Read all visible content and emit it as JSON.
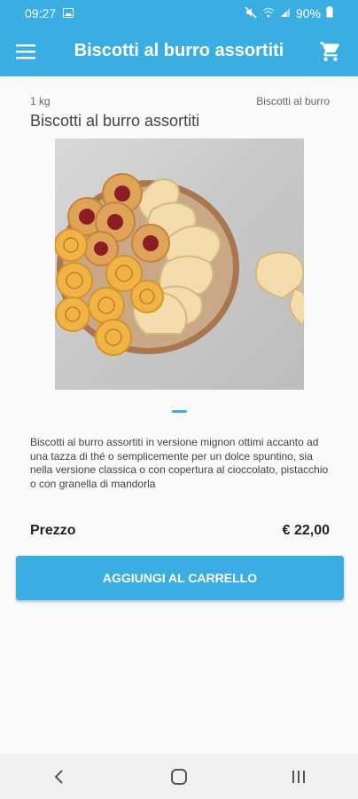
{
  "status_bar": {
    "time": "09:27",
    "battery": "90%",
    "icons": [
      "image-icon",
      "mute-icon",
      "wifi-icon",
      "signal-icon",
      "battery-icon"
    ]
  },
  "app_bar": {
    "title": "Biscotti al burro assortiti",
    "menu_icon": "menu-icon",
    "cart_icon": "cart-icon"
  },
  "product": {
    "weight": "1 kg",
    "category": "Biscotti al burro",
    "title": "Biscotti al burro assortiti",
    "description": "Biscotti al burro assortiti in versione mignon ottimi accanto ad una tazza di thé o semplicemente per un dolce spuntino, sia nella versione classica o con copertura al cioccolato, pistacchio  o con granella di mandorla",
    "price_label": "Prezzo",
    "price_value": "€ 22,00",
    "add_to_cart_label": "AGGIUNGI AL CARRELLO"
  },
  "nav_bar": {
    "icons": [
      "back-icon",
      "home-icon",
      "recents-icon"
    ]
  },
  "colors": {
    "primary": "#3aaee3",
    "background": "#fafafa",
    "nav_background": "#f0f0f0"
  }
}
